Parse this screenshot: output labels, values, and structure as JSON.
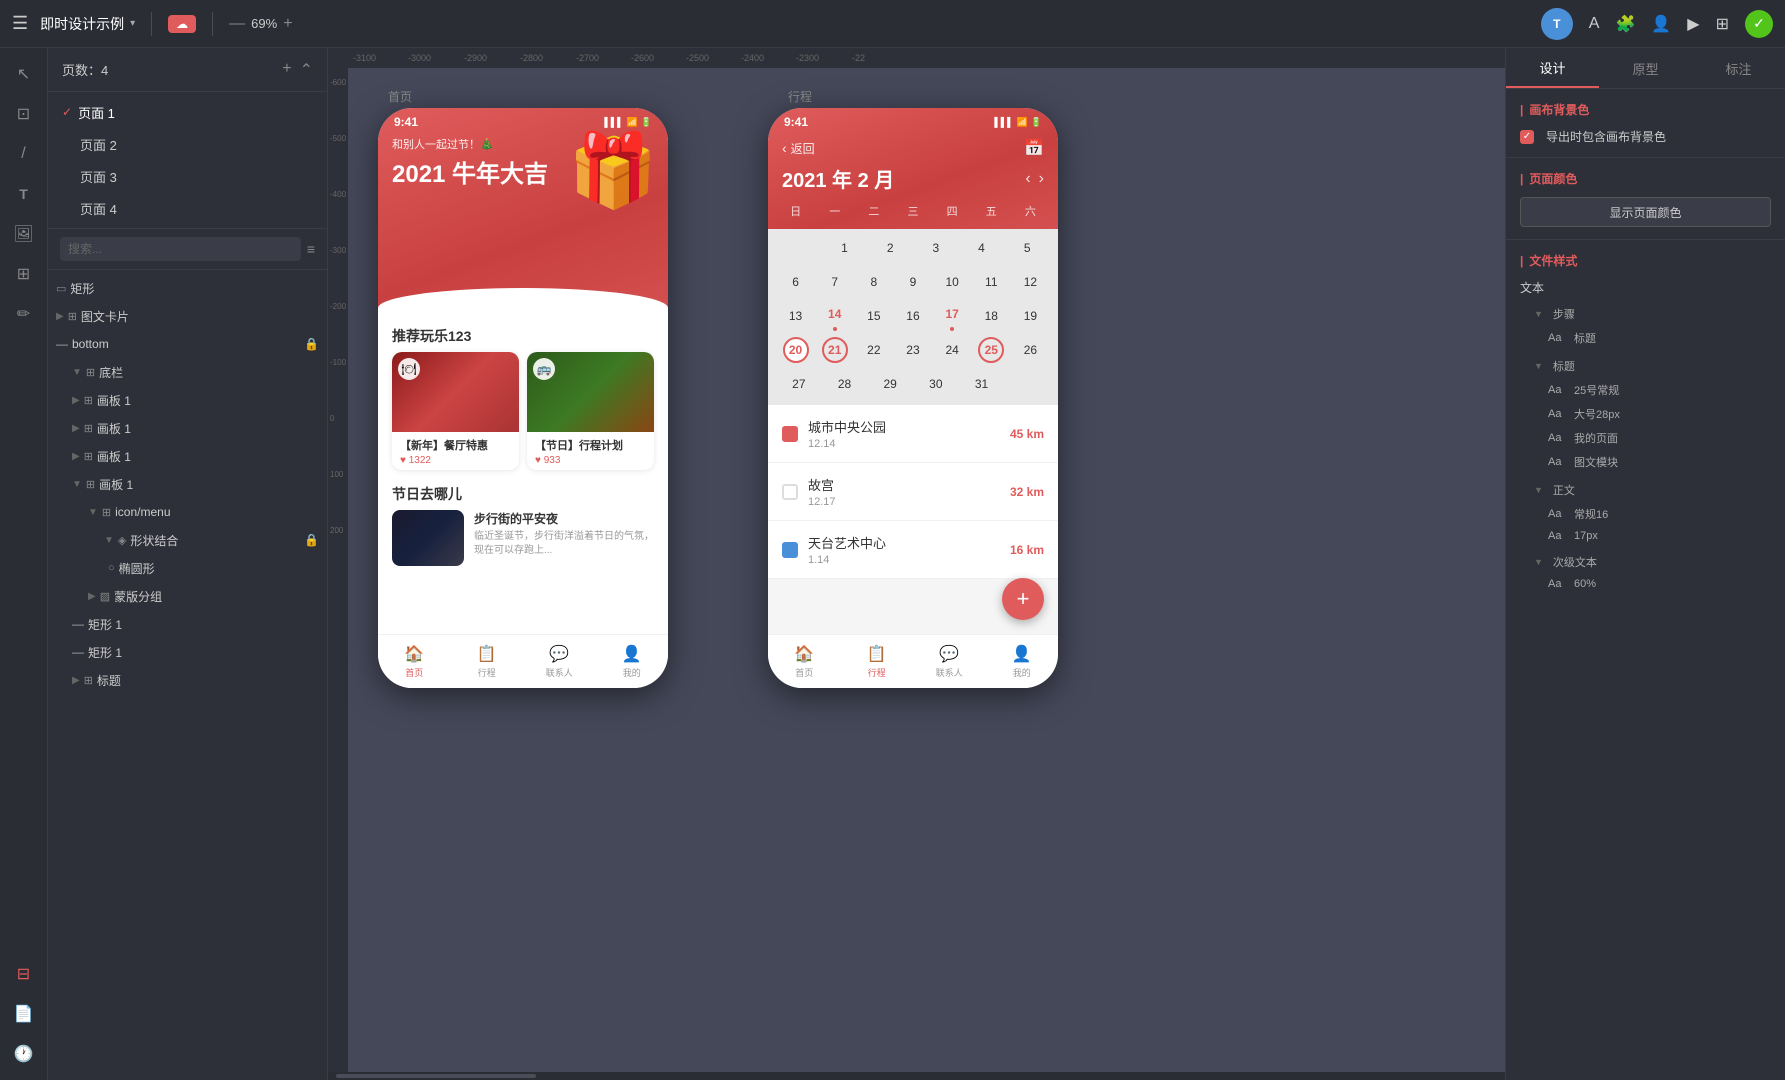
{
  "toolbar": {
    "menu_label": "☰",
    "title": "即时设计示例",
    "dropdown_arrow": "▾",
    "zoom": "69%",
    "minus": "—",
    "plus": "+",
    "avatar": "T",
    "font_icon": "A",
    "plugin_icon": "🧩",
    "users_icon": "👤",
    "play_icon": "▶",
    "template_icon": "⊞",
    "check_icon": "✓"
  },
  "sidebar": {
    "pages_label": "页数：4",
    "pages": [
      {
        "label": "页面 1",
        "active": true
      },
      {
        "label": "页面 2",
        "active": false
      },
      {
        "label": "页面 3",
        "active": false
      },
      {
        "label": "页面 4",
        "active": false
      }
    ],
    "search_placeholder": "搜索...",
    "layers": [
      {
        "indent": 0,
        "icon": "▭",
        "label": "矩形",
        "expandable": false
      },
      {
        "indent": 1,
        "icon": "⊞",
        "label": "图文卡片",
        "expandable": true
      },
      {
        "indent": 0,
        "icon": "—",
        "label": "bottom",
        "expandable": false,
        "locked": true
      },
      {
        "indent": 1,
        "icon": "⊞",
        "label": "底栏",
        "expandable": true
      },
      {
        "indent": 2,
        "icon": "⊞",
        "label": "画板 1",
        "expandable": true
      },
      {
        "indent": 2,
        "icon": "⊞",
        "label": "画板 1",
        "expandable": true
      },
      {
        "indent": 2,
        "icon": "⊞",
        "label": "画板 1",
        "expandable": true
      },
      {
        "indent": 2,
        "icon": "⊞",
        "label": "画板 1",
        "expandable": true
      },
      {
        "indent": 3,
        "icon": "⊞",
        "label": "icon/menu",
        "expandable": true
      },
      {
        "indent": 4,
        "icon": "◎",
        "label": "形状结合",
        "expandable": true,
        "locked": true
      },
      {
        "indent": 4,
        "icon": "○",
        "label": "椭圆形",
        "expandable": false
      },
      {
        "indent": 3,
        "icon": "▨",
        "label": "蒙版分组",
        "expandable": true
      },
      {
        "indent": 2,
        "icon": "—",
        "label": "矩形 1",
        "expandable": false
      },
      {
        "indent": 2,
        "icon": "—",
        "label": "矩形 1",
        "expandable": false
      },
      {
        "indent": 2,
        "icon": "⊞",
        "label": "标题",
        "expandable": true
      }
    ]
  },
  "canvas": {
    "rulers": [
      "-3100",
      "-3000",
      "-2900",
      "-2800",
      "-2700",
      "-2600",
      "-2500",
      "-2400",
      "-2300",
      "-22"
    ],
    "page_label_home": "首页",
    "page_label_itinerary": "行程",
    "vruler_marks": [
      "-600",
      "-500",
      "-400",
      "-300",
      "-200",
      "-100",
      "0",
      "100",
      "200"
    ]
  },
  "home_phone": {
    "status_time": "9:41",
    "banner_small": "和别人一起过节！🎄",
    "banner_large": "2021 牛年大吉",
    "section1_title": "推荐玩乐123",
    "card1_icon": "🍽",
    "card1_title": "【新年】餐厅特惠",
    "card1_likes": "♥ 1322",
    "card2_icon": "🚌",
    "card2_title": "【节日】行程计划",
    "card2_likes": "♥ 933",
    "section2_title": "节日去哪儿",
    "list1_title": "步行街的平安夜",
    "list1_desc": "临近圣诞节，步行街洋溢着节日的气氛，现在可以存跑上...",
    "nav_home": "首页",
    "nav_itinerary": "行程",
    "nav_contacts": "联系人",
    "nav_mine": "我的"
  },
  "itinerary_phone": {
    "status_time": "9:41",
    "back_label": "返回",
    "cal_title": "2021 年 2 月",
    "weekdays": [
      "日",
      "一",
      "二",
      "三",
      "四",
      "五",
      "六"
    ],
    "cal_rows": [
      [
        null,
        "1",
        "2",
        "3",
        "4",
        "5"
      ],
      [
        "6",
        "7",
        "8",
        "9",
        "10",
        "11",
        "12"
      ],
      [
        "13",
        "14",
        "15",
        "16",
        "17",
        "18",
        "19"
      ],
      [
        "20",
        "21",
        "22",
        "23",
        "24",
        "25",
        "26"
      ],
      [
        "27",
        "28",
        "29",
        "30",
        "31",
        null
      ]
    ],
    "today": "20",
    "circled": [
      "21",
      "25"
    ],
    "dotted": [
      "14",
      "17"
    ],
    "items": [
      {
        "name": "城市中央公园",
        "date": "12.14",
        "dist": "45 km"
      },
      {
        "name": "故宫",
        "date": "12.17",
        "dist": "32 km"
      },
      {
        "name": "天台艺术中心",
        "date": "1.14",
        "dist": "16 km"
      }
    ],
    "fab_icon": "+",
    "nav_home": "首页",
    "nav_itinerary": "行程",
    "nav_contacts": "联系人",
    "nav_mine": "我的"
  },
  "right_panel": {
    "tabs": [
      "设计",
      "原型",
      "标注"
    ],
    "active_tab": "设计",
    "canvas_bg_label": "画布背景色",
    "export_label": "导出时包含画布背景色",
    "page_color_label": "页面颜色",
    "show_color_btn": "显示页面颜色",
    "file_style_label": "文件样式",
    "text_label": "文本",
    "category_steps": "步骤",
    "steps_item": "Aa 标题",
    "category_title": "标题",
    "title_items": [
      "Aa 25号常规",
      "Aa 大号28px",
      "Aa 我的页面",
      "Aa 图文模块"
    ],
    "category_body": "正文",
    "body_items": [
      "Aa 常规16",
      "Aa 17px"
    ],
    "category_secondary": "次级文本",
    "secondary_items": [
      "Aa 60%"
    ]
  }
}
